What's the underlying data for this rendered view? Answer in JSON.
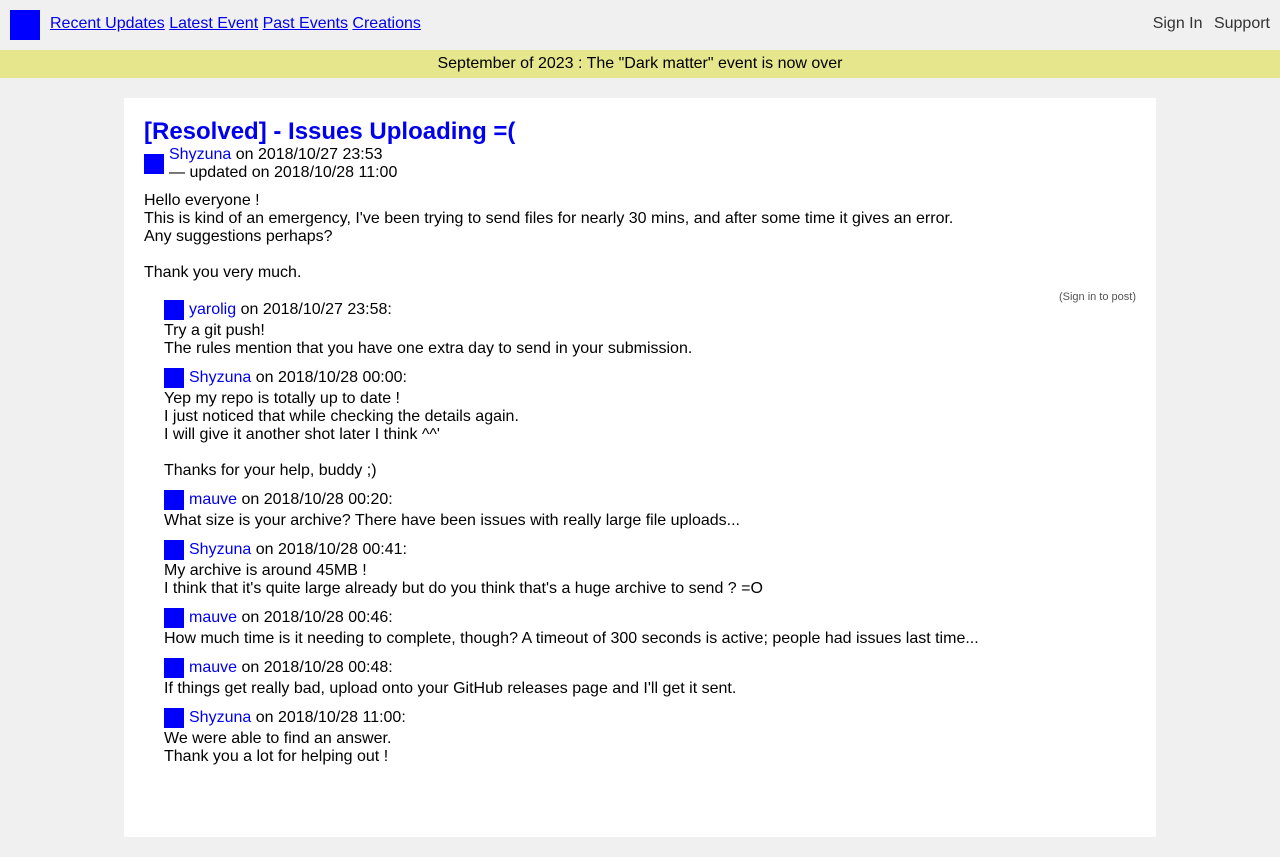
{
  "nav": {
    "left": [
      "Recent Updates",
      "Latest Event",
      "Past Events",
      "Creations"
    ],
    "right": [
      "Sign In",
      "Support"
    ]
  },
  "banner": "September of 2023 : The \"Dark matter\" event is now over",
  "post": {
    "title": "[Resolved] - Issues Uploading =(",
    "author": "Shyzuna",
    "posted": "on 2018/10/27 23:53",
    "updated": "— updated on 2018/10/28 11:00",
    "paragraphs": [
      "Hello everyone !\nThis is kind of an emergency, I've been trying to send files for nearly 30 mins, and after some time it gives an error.\nAny suggestions perhaps?",
      "Thank you very much."
    ]
  },
  "signin_note": "(Sign in to post)",
  "comments": [
    {
      "user": "yarolig",
      "when": "on 2018/10/27 23:58:",
      "paragraphs": [
        "Try a git push!\nThe rules mention that you have one extra day to send in your submission."
      ]
    },
    {
      "user": "Shyzuna",
      "when": "on 2018/10/28 00:00:",
      "paragraphs": [
        "Yep my repo is totally up to date !\nI just noticed that while checking the details again.\nI will give it another shot later I think ^^'",
        "Thanks for your help, buddy ;)"
      ]
    },
    {
      "user": "mauve",
      "when": "on 2018/10/28 00:20:",
      "paragraphs": [
        "What size is your archive? There have been issues with really large file uploads..."
      ]
    },
    {
      "user": "Shyzuna",
      "when": "on 2018/10/28 00:41:",
      "paragraphs": [
        "My archive is around 45MB !\nI think that it's quite large already but do you think that's a huge archive to send ? =O"
      ]
    },
    {
      "user": "mauve",
      "when": "on 2018/10/28 00:46:",
      "paragraphs": [
        "How much time is it needing to complete, though? A timeout of 300 seconds is active; people had issues last time..."
      ]
    },
    {
      "user": "mauve",
      "when": "on 2018/10/28 00:48:",
      "paragraphs": [
        "If things get really bad, upload onto your GitHub releases page and I'll get it sent."
      ]
    },
    {
      "user": "Shyzuna",
      "when": "on 2018/10/28 11:00:",
      "paragraphs": [
        "We were able to find an answer.\nThank you a lot for helping out !"
      ]
    }
  ],
  "colors": {
    "background": "#f0f0f0",
    "banner": "#e6e68c",
    "link": "#0000ee",
    "avatar": "#0000ff"
  }
}
